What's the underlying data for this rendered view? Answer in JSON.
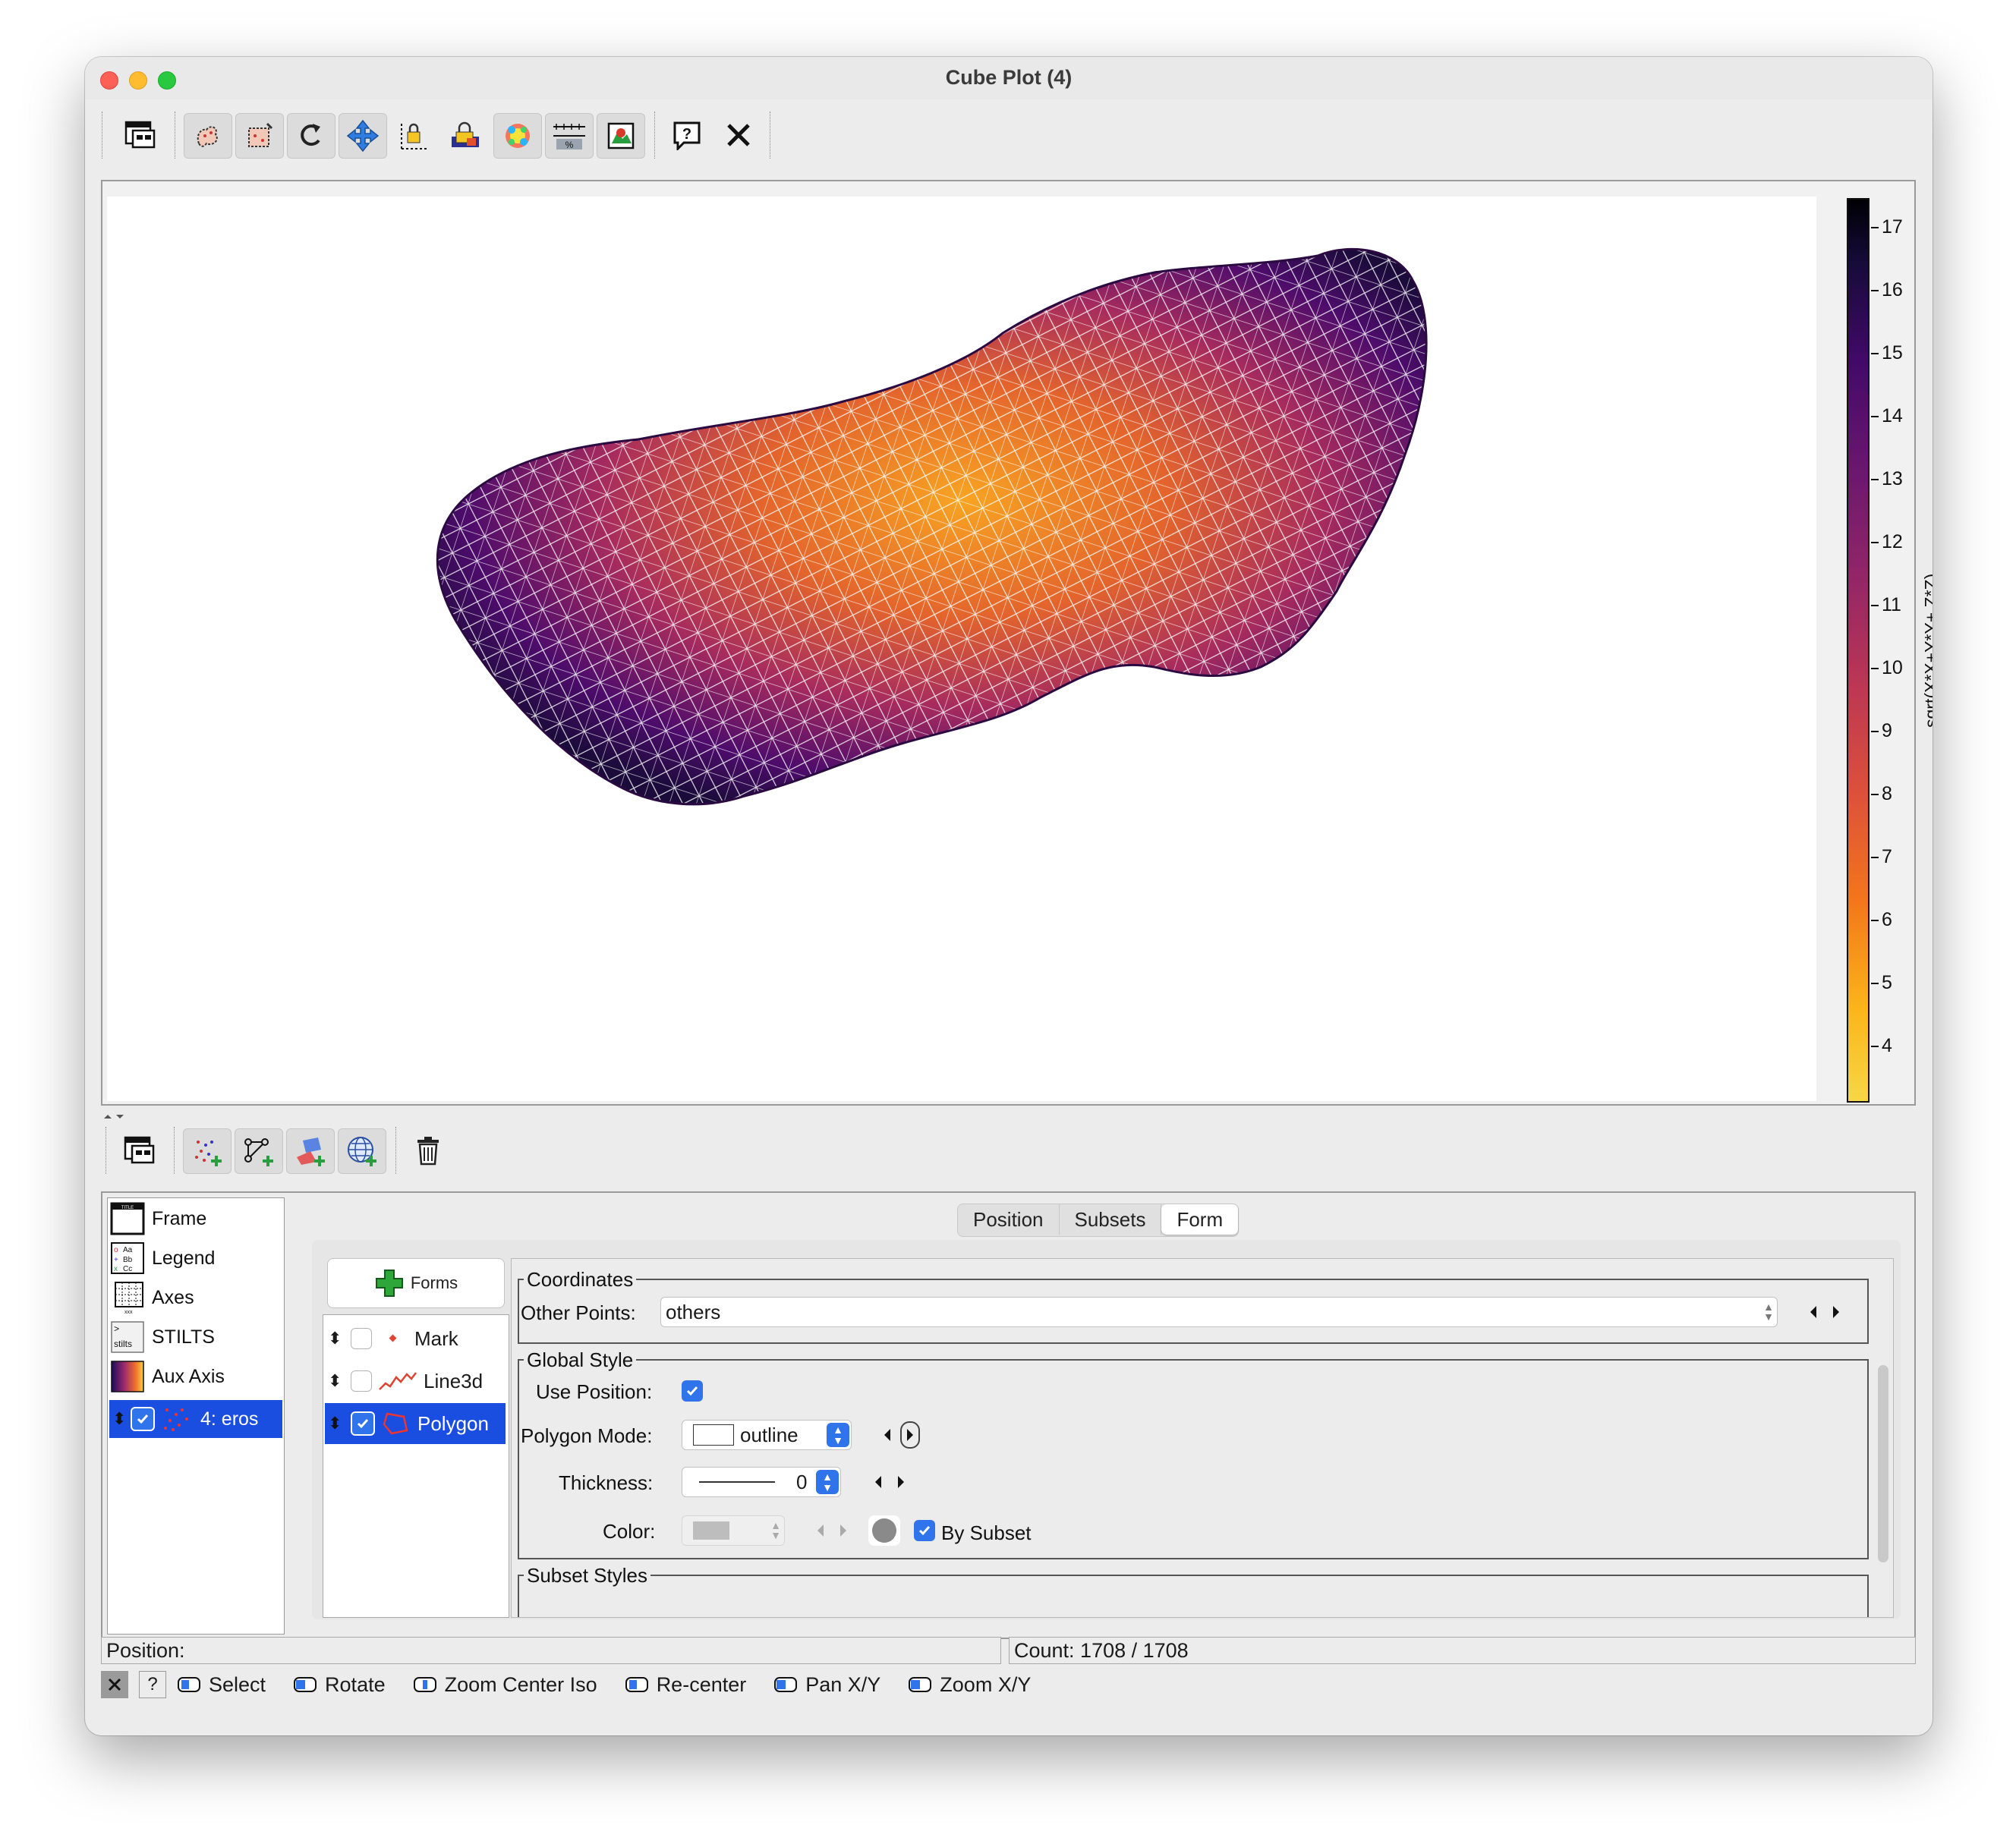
{
  "window": {
    "title": "Cube Plot (4)"
  },
  "toolbar": {
    "buttons": [
      "window-new-icon",
      "blob-subset-icon",
      "draw-subset-icon",
      "replot-icon",
      "navigate-icon",
      "fix-range-icon",
      "resize-icon",
      "highlight-icon",
      "axis-lock-icon",
      "export-icon",
      "help-icon",
      "close-icon"
    ]
  },
  "colorbar": {
    "axis_label": "sqrt(X*X+Y*Y+ Z*Z)",
    "ticks": [
      "17",
      "16",
      "15",
      "14",
      "13",
      "12",
      "11",
      "10",
      "9",
      "8",
      "7",
      "6",
      "5",
      "4"
    ],
    "range": [
      3.3,
      17.6
    ],
    "colormap": "inferno (reversed)"
  },
  "control_list": {
    "items": [
      {
        "label": "Frame"
      },
      {
        "label": "Legend"
      },
      {
        "label": "Axes"
      },
      {
        "label": "STILTS"
      },
      {
        "label": "Aux Axis"
      },
      {
        "label": "4: eros"
      }
    ]
  },
  "tabs": {
    "items": [
      "Position",
      "Subsets",
      "Form"
    ],
    "active": "Form"
  },
  "forms": {
    "button_label": "Forms",
    "items": [
      {
        "label": "Mark",
        "checked": false
      },
      {
        "label": "Line3d",
        "checked": false
      },
      {
        "label": "Polygon",
        "checked": true
      }
    ]
  },
  "form_panel": {
    "coordinates": {
      "title": "Coordinates",
      "other_points_label": "Other Points:",
      "other_points_value": "others"
    },
    "global_style": {
      "title": "Global Style",
      "use_position_label": "Use Position:",
      "use_position_checked": true,
      "polygon_mode_label": "Polygon Mode:",
      "polygon_mode_value": "outline",
      "thickness_label": "Thickness:",
      "thickness_value": "0",
      "color_label": "Color:",
      "by_subset_label": "By Subset",
      "by_subset_checked": true
    },
    "subset_styles": {
      "title": "Subset Styles"
    }
  },
  "status": {
    "position_label": "Position:",
    "count_label": "Count: 1708 / 1708"
  },
  "mouse_hints": {
    "items": [
      "Select",
      "Rotate",
      "Zoom Center Iso",
      "Re-center",
      "Pan X/Y",
      "Zoom X/Y"
    ]
  }
}
